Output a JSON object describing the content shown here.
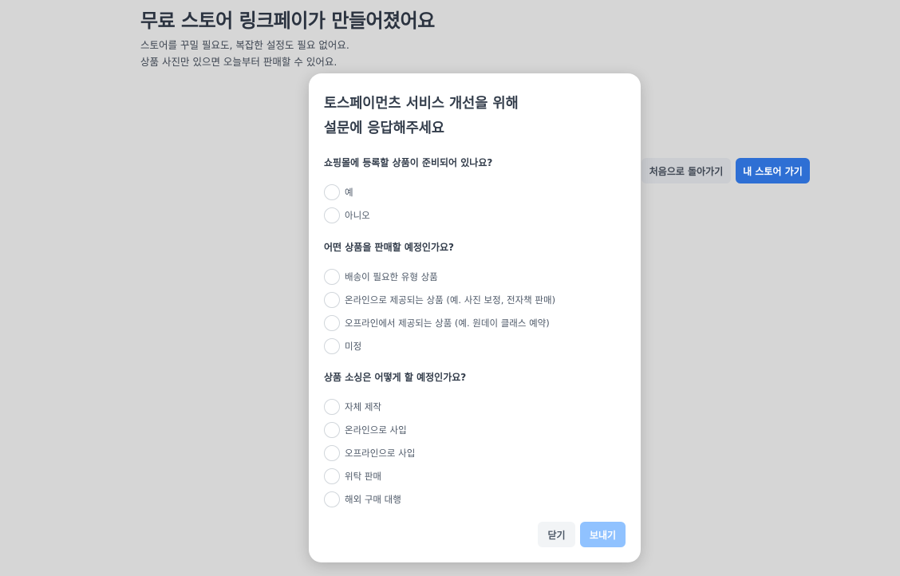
{
  "background": {
    "title": "무료 스토어 링크페이가 만들어졌어요",
    "desc_line1": "스토어를 꾸밀 필요도, 복잡한 설정도 필요 없어요.",
    "desc_line2": "상품 사진만 있으면 오늘부터 판매할 수 있어요.",
    "back_button": "처음으로 돌아가기",
    "store_button": "내 스토어 가기"
  },
  "modal": {
    "title_line1": "토스페이먼츠 서비스 개선을 위해",
    "title_line2": "설문에 응답해주세요",
    "questions": [
      {
        "label": "쇼핑몰에 등록할 상품이 준비되어 있나요?",
        "options": [
          "예",
          "아니오"
        ]
      },
      {
        "label": "어떤 상품을 판매할 예정인가요?",
        "options": [
          "배송이 필요한 유형 상품",
          "온라인으로 제공되는 상품 (예. 사진 보정, 전자책 판매)",
          "오프라인에서 제공되는 상품 (예. 원데이 클래스 예약)",
          "미정"
        ]
      },
      {
        "label": "상품 소싱은 어떻게 할 예정인가요?",
        "options": [
          "자체 제작",
          "온라인으로 사입",
          "오프라인으로 사입",
          "위탁 판매",
          "해외 구매 대행"
        ]
      }
    ],
    "close_button": "닫기",
    "send_button": "보내기"
  }
}
